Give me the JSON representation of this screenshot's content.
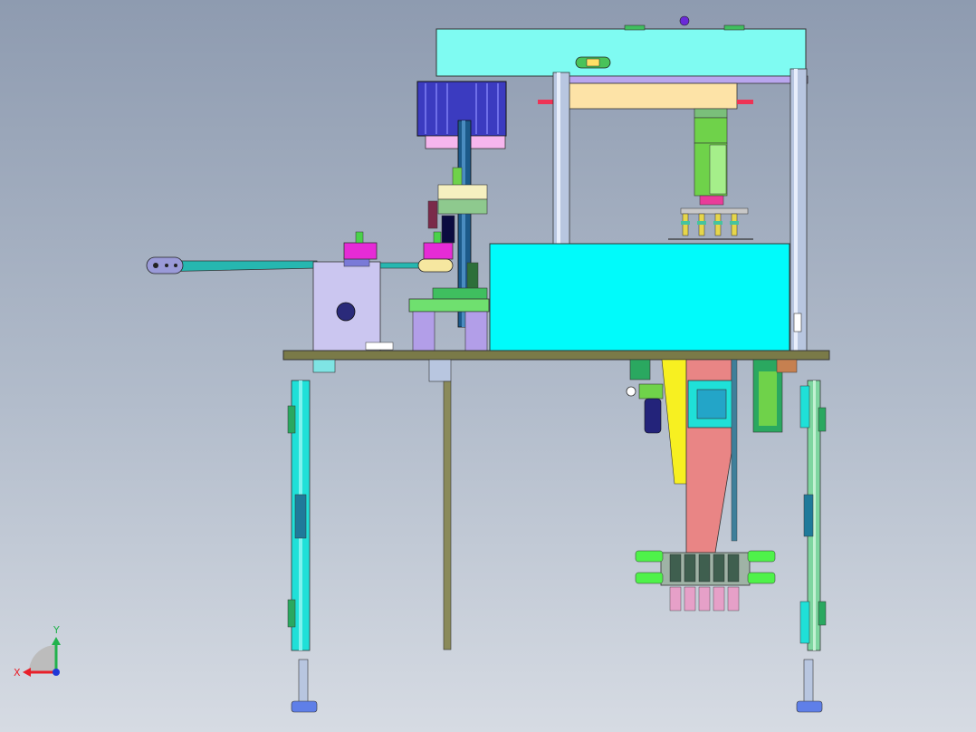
{
  "view": {
    "background_top": "#8e9bb0",
    "background_bottom": "#d6dbe3"
  },
  "triad": {
    "x_label": "X",
    "y_label": "Y",
    "x_color": "#e8202a",
    "y_color": "#22b24c",
    "z_color": "#2038d8"
  },
  "model_colors": {
    "top_plate": "#7ffbf2",
    "cyan_box": "#00fbfb",
    "base_plate": "#7a7a48",
    "column": "#b8c6e0",
    "motor": "#3b3bc0",
    "motor_flange": "#f6b6ee",
    "gearbox": "#a9a6e8",
    "magenta_block": "#e62bd6",
    "orange_plate": "#fde3a7",
    "green_part": "#6fd24a",
    "pink_hopper": "#e98585",
    "yellow_chute": "#f7f021",
    "leg_cyan": "#1fe0d8",
    "leg_green": "#7ed6a0"
  }
}
